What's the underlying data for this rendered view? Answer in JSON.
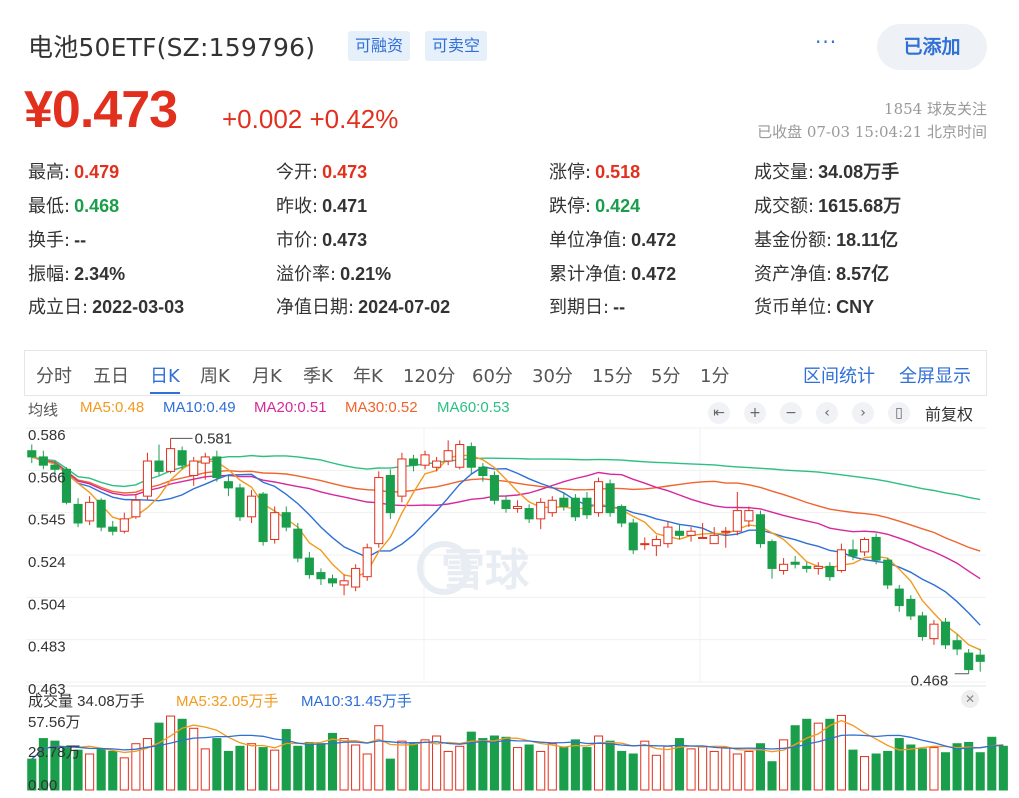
{
  "header": {
    "title": "电池50ETF(SZ:159796)",
    "tags": [
      "可融资",
      "可卖空"
    ],
    "more_label": "···",
    "added_label": "已添加",
    "price": "¥0.473",
    "change": "+0.002 +0.42%",
    "followers": "1854 球友关注",
    "status": "已收盘 07-03 15:04:21 北京时间"
  },
  "quote": {
    "rows": [
      [
        {
          "label": "最高:",
          "value": "0.479",
          "tone": "up"
        },
        {
          "label": "今开:",
          "value": "0.473",
          "tone": "up"
        },
        {
          "label": "涨停:",
          "value": "0.518",
          "tone": "up"
        },
        {
          "label": "成交量:",
          "value": "34.08万手",
          "tone": ""
        }
      ],
      [
        {
          "label": "最低:",
          "value": "0.468",
          "tone": "down"
        },
        {
          "label": "昨收:",
          "value": "0.471",
          "tone": ""
        },
        {
          "label": "跌停:",
          "value": "0.424",
          "tone": "down"
        },
        {
          "label": "成交额:",
          "value": "1615.68万",
          "tone": ""
        }
      ],
      [
        {
          "label": "换手:",
          "value": "--",
          "tone": ""
        },
        {
          "label": "市价:",
          "value": "0.473",
          "tone": ""
        },
        {
          "label": "单位净值:",
          "value": "0.472",
          "tone": ""
        },
        {
          "label": "基金份额:",
          "value": "18.11亿",
          "tone": ""
        }
      ],
      [
        {
          "label": "振幅:",
          "value": "2.34%",
          "tone": ""
        },
        {
          "label": "溢价率:",
          "value": "0.21%",
          "tone": ""
        },
        {
          "label": "累计净值:",
          "value": "0.472",
          "tone": ""
        },
        {
          "label": "资产净值:",
          "value": "8.57亿",
          "tone": ""
        }
      ],
      [
        {
          "label": "成立日:",
          "value": "2022-03-03",
          "tone": ""
        },
        {
          "label": "净值日期:",
          "value": "2024-07-02",
          "tone": ""
        },
        {
          "label": "到期日:",
          "value": "--",
          "tone": ""
        },
        {
          "label": "货币单位:",
          "value": "CNY",
          "tone": ""
        }
      ]
    ]
  },
  "tabs": {
    "items": [
      "分时",
      "五日",
      "日K",
      "周K",
      "月K",
      "季K",
      "年K",
      "120分",
      "60分",
      "30分",
      "15分",
      "5分",
      "1分"
    ],
    "active": "日K",
    "range_stats": "区间统计",
    "fullscreen": "全屏显示"
  },
  "ma_legend": {
    "label": "均线",
    "ma5": "MA5:0.48",
    "ma10": "MA10:0.49",
    "ma20": "MA20:0.51",
    "ma30": "MA30:0.52",
    "ma60": "MA60:0.53",
    "fuquan": "前复权"
  },
  "controls": [
    "⇤",
    "+",
    "−",
    "‹",
    "›",
    "▯"
  ],
  "volume_legend": {
    "vol": "成交量 34.08万手",
    "ma5": "MA5:32.05万手",
    "ma10": "MA10:31.45万手"
  },
  "colors": {
    "up": "#e1301d",
    "down": "#1a9e4b",
    "ma5": "#f29a1f",
    "ma10": "#2f6fd6",
    "ma20": "#d6289c",
    "ma30": "#f0642d",
    "ma60": "#2cbf83"
  },
  "watermark": "雪球",
  "chart_data": {
    "type": "candlestick",
    "y_ticks": [
      "0.586",
      "0.566",
      "0.545",
      "0.524",
      "0.504",
      "0.483",
      "0.463"
    ],
    "ylim": [
      0.463,
      0.586
    ],
    "high_label": "0.581",
    "low_label": "0.468",
    "volume_ticks": [
      "57.56万",
      "28.78万",
      "0.00"
    ],
    "volume_max": 57.56,
    "candles": [
      [
        0.575,
        0.572,
        0.578,
        0.569
      ],
      [
        0.572,
        0.568,
        0.575,
        0.566
      ],
      [
        0.568,
        0.566,
        0.57,
        0.562
      ],
      [
        0.566,
        0.55,
        0.567,
        0.549
      ],
      [
        0.549,
        0.54,
        0.552,
        0.538
      ],
      [
        0.541,
        0.55,
        0.553,
        0.539
      ],
      [
        0.551,
        0.538,
        0.552,
        0.536
      ],
      [
        0.538,
        0.536,
        0.541,
        0.534
      ],
      [
        0.536,
        0.542,
        0.545,
        0.535
      ],
      [
        0.543,
        0.551,
        0.554,
        0.542
      ],
      [
        0.553,
        0.57,
        0.574,
        0.551
      ],
      [
        0.57,
        0.565,
        0.578,
        0.563
      ],
      [
        0.565,
        0.576,
        0.581,
        0.564
      ],
      [
        0.575,
        0.568,
        0.577,
        0.566
      ],
      [
        0.563,
        0.57,
        0.572,
        0.558
      ],
      [
        0.569,
        0.572,
        0.574,
        0.561
      ],
      [
        0.572,
        0.562,
        0.575,
        0.56
      ],
      [
        0.56,
        0.557,
        0.563,
        0.553
      ],
      [
        0.557,
        0.543,
        0.559,
        0.541
      ],
      [
        0.543,
        0.553,
        0.556,
        0.54
      ],
      [
        0.554,
        0.531,
        0.555,
        0.529
      ],
      [
        0.532,
        0.545,
        0.548,
        0.53
      ],
      [
        0.545,
        0.538,
        0.548,
        0.536
      ],
      [
        0.537,
        0.523,
        0.54,
        0.521
      ],
      [
        0.523,
        0.515,
        0.526,
        0.513
      ],
      [
        0.516,
        0.513,
        0.518,
        0.51
      ],
      [
        0.513,
        0.511,
        0.515,
        0.509
      ],
      [
        0.51,
        0.512,
        0.515,
        0.505
      ],
      [
        0.509,
        0.518,
        0.52,
        0.507
      ],
      [
        0.514,
        0.528,
        0.53,
        0.512
      ],
      [
        0.53,
        0.562,
        0.565,
        0.528
      ],
      [
        0.563,
        0.545,
        0.566,
        0.542
      ],
      [
        0.553,
        0.571,
        0.574,
        0.55
      ],
      [
        0.571,
        0.568,
        0.573,
        0.565
      ],
      [
        0.568,
        0.573,
        0.575,
        0.566
      ],
      [
        0.567,
        0.57,
        0.572,
        0.565
      ],
      [
        0.57,
        0.575,
        0.58,
        0.568
      ],
      [
        0.567,
        0.578,
        0.58,
        0.566
      ],
      [
        0.577,
        0.567,
        0.579,
        0.564
      ],
      [
        0.567,
        0.563,
        0.569,
        0.56
      ],
      [
        0.563,
        0.551,
        0.565,
        0.549
      ],
      [
        0.551,
        0.547,
        0.553,
        0.545
      ],
      [
        0.547,
        0.548,
        0.551,
        0.545
      ],
      [
        0.547,
        0.542,
        0.549,
        0.54
      ],
      [
        0.542,
        0.55,
        0.552,
        0.537
      ],
      [
        0.545,
        0.551,
        0.553,
        0.543
      ],
      [
        0.552,
        0.548,
        0.555,
        0.546
      ],
      [
        0.552,
        0.543,
        0.554,
        0.541
      ],
      [
        0.552,
        0.544,
        0.555,
        0.542
      ],
      [
        0.545,
        0.56,
        0.562,
        0.543
      ],
      [
        0.559,
        0.545,
        0.561,
        0.543
      ],
      [
        0.548,
        0.54,
        0.549,
        0.538
      ],
      [
        0.54,
        0.527,
        0.542,
        0.525
      ],
      [
        0.53,
        0.53,
        0.533,
        0.527
      ],
      [
        0.529,
        0.532,
        0.534,
        0.524
      ],
      [
        0.53,
        0.538,
        0.541,
        0.528
      ],
      [
        0.536,
        0.534,
        0.539,
        0.532
      ],
      [
        0.534,
        0.536,
        0.538,
        0.531
      ],
      [
        0.533,
        0.533,
        0.54,
        0.533
      ],
      [
        0.53,
        0.534,
        0.538,
        0.531
      ],
      [
        0.536,
        0.536,
        0.538,
        0.528
      ],
      [
        0.536,
        0.546,
        0.555,
        0.534
      ],
      [
        0.541,
        0.546,
        0.548,
        0.538
      ],
      [
        0.544,
        0.53,
        0.546,
        0.528
      ],
      [
        0.531,
        0.518,
        0.532,
        0.513
      ],
      [
        0.517,
        0.52,
        0.523,
        0.515
      ],
      [
        0.521,
        0.52,
        0.524,
        0.518
      ],
      [
        0.519,
        0.518,
        0.521,
        0.516
      ],
      [
        0.518,
        0.519,
        0.521,
        0.515
      ],
      [
        0.519,
        0.514,
        0.521,
        0.512
      ],
      [
        0.517,
        0.527,
        0.53,
        0.516
      ],
      [
        0.527,
        0.524,
        0.532,
        0.522
      ],
      [
        0.526,
        0.532,
        0.533,
        0.524
      ],
      [
        0.533,
        0.522,
        0.535,
        0.52
      ],
      [
        0.522,
        0.51,
        0.523,
        0.508
      ],
      [
        0.508,
        0.5,
        0.51,
        0.497
      ],
      [
        0.503,
        0.495,
        0.505,
        0.493
      ],
      [
        0.495,
        0.485,
        0.497,
        0.483
      ],
      [
        0.484,
        0.491,
        0.493,
        0.481
      ],
      [
        0.492,
        0.481,
        0.494,
        0.479
      ],
      [
        0.483,
        0.479,
        0.486,
        0.476
      ],
      [
        0.477,
        0.469,
        0.479,
        0.467
      ],
      [
        0.476,
        0.473,
        0.479,
        0.468
      ]
    ],
    "volumes": [
      24,
      40,
      38,
      33,
      31,
      28,
      32,
      30,
      25,
      36,
      40,
      52,
      57.5,
      55,
      48,
      32,
      40,
      30,
      34,
      36,
      33,
      31,
      47,
      34,
      37,
      36,
      44,
      40,
      35,
      28,
      50,
      24,
      38,
      36,
      39,
      42,
      30,
      34,
      45,
      40,
      42,
      41,
      33,
      35,
      30,
      36,
      33,
      39,
      33,
      42,
      38,
      30,
      28,
      38,
      27,
      34,
      40,
      32,
      34,
      30,
      33,
      28,
      30,
      36,
      22,
      39,
      50,
      55,
      52,
      55,
      58,
      31,
      26,
      28,
      30,
      40,
      35,
      32,
      33,
      29,
      36,
      37,
      29,
      41,
      34
    ]
  }
}
